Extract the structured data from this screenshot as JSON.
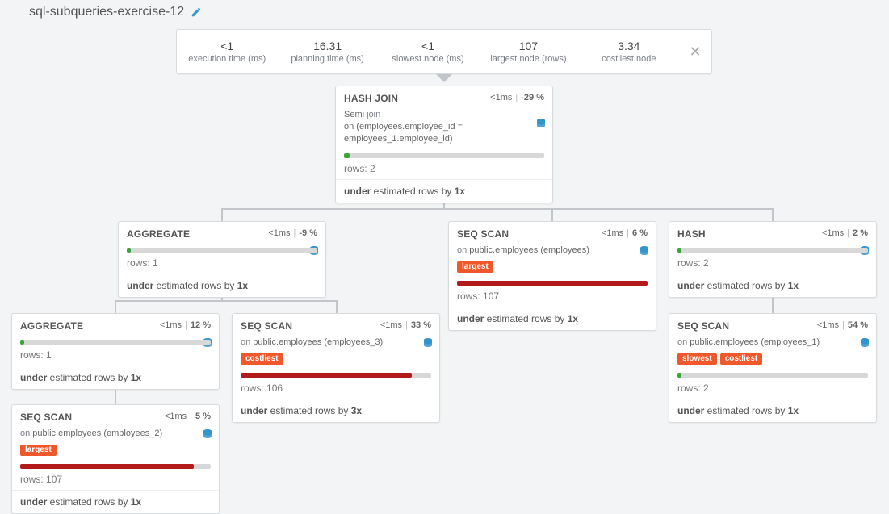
{
  "title": "sql-subqueries-exercise-12",
  "stats": {
    "exec": {
      "value": "<1",
      "label": "execution time (ms)"
    },
    "plan": {
      "value": "16.31",
      "label": "planning time (ms)"
    },
    "slowest": {
      "value": "<1",
      "label": "slowest node (ms)"
    },
    "largest": {
      "value": "107",
      "label": "largest node (rows)"
    },
    "cost": {
      "value": "3.34",
      "label": "costliest node"
    }
  },
  "labels": {
    "rows_prefix": "rows: ",
    "under_prefix": "under",
    "est_mid": " estimated rows by ",
    "on_prefix": "on "
  },
  "nodes": {
    "hashjoin": {
      "name": "HASH JOIN",
      "time": "<1ms",
      "pct": "-29 %",
      "desc_pre": "Semi ",
      "desc_kw": "join",
      "desc_on": "on (employees.employee_id = employees_1.employee_id)",
      "rows": "2",
      "est_x": "1x",
      "bar_pct": 3,
      "bar_color": "green"
    },
    "agg1": {
      "name": "AGGREGATE",
      "time": "<1ms",
      "pct": "-9 %",
      "rows": "1",
      "est_x": "1x",
      "bar_pct": 2,
      "bar_color": "green"
    },
    "seqscan1": {
      "name": "SEQ SCAN",
      "time": "<1ms",
      "pct": "6 %",
      "on": "public.employees (employees)",
      "rows": "107",
      "est_x": "1x",
      "badges": [
        "largest"
      ],
      "bar_pct": 100,
      "bar_color": "red"
    },
    "hash": {
      "name": "HASH",
      "time": "<1ms",
      "pct": "2 %",
      "rows": "2",
      "est_x": "1x",
      "bar_pct": 2,
      "bar_color": "green"
    },
    "agg2": {
      "name": "AGGREGATE",
      "time": "<1ms",
      "pct": "12 %",
      "rows": "1",
      "est_x": "1x",
      "bar_pct": 2,
      "bar_color": "green"
    },
    "seqscan3": {
      "name": "SEQ SCAN",
      "time": "<1ms",
      "pct": "33 %",
      "on": "public.employees (employees_3)",
      "rows": "106",
      "est_x": "3x",
      "badges": [
        "costliest"
      ],
      "bar_pct": 90,
      "bar_color": "red"
    },
    "seqscan4": {
      "name": "SEQ SCAN",
      "time": "<1ms",
      "pct": "54 %",
      "on": "public.employees (employees_1)",
      "rows": "2",
      "est_x": "1x",
      "badges": [
        "slowest",
        "costliest"
      ],
      "bar_pct": 2,
      "bar_color": "green"
    },
    "seqscan2": {
      "name": "SEQ SCAN",
      "time": "<1ms",
      "pct": "5 %",
      "on": "public.employees (employees_2)",
      "rows": "107",
      "est_x": "1x",
      "badges": [
        "largest"
      ],
      "bar_pct": 91,
      "bar_color": "red"
    }
  }
}
